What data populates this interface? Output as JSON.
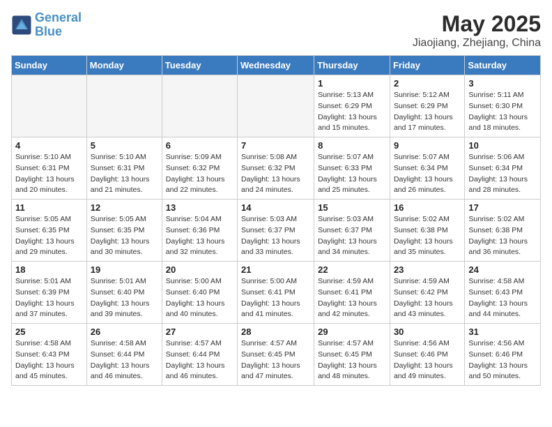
{
  "header": {
    "logo_line1": "General",
    "logo_line2": "Blue",
    "month": "May 2025",
    "location": "Jiaojiang, Zhejiang, China"
  },
  "days_of_week": [
    "Sunday",
    "Monday",
    "Tuesday",
    "Wednesday",
    "Thursday",
    "Friday",
    "Saturday"
  ],
  "weeks": [
    [
      {
        "num": "",
        "info": "",
        "empty": true
      },
      {
        "num": "",
        "info": "",
        "empty": true
      },
      {
        "num": "",
        "info": "",
        "empty": true
      },
      {
        "num": "",
        "info": "",
        "empty": true
      },
      {
        "num": "1",
        "info": "Sunrise: 5:13 AM\nSunset: 6:29 PM\nDaylight: 13 hours\nand 15 minutes."
      },
      {
        "num": "2",
        "info": "Sunrise: 5:12 AM\nSunset: 6:29 PM\nDaylight: 13 hours\nand 17 minutes."
      },
      {
        "num": "3",
        "info": "Sunrise: 5:11 AM\nSunset: 6:30 PM\nDaylight: 13 hours\nand 18 minutes."
      }
    ],
    [
      {
        "num": "4",
        "info": "Sunrise: 5:10 AM\nSunset: 6:31 PM\nDaylight: 13 hours\nand 20 minutes."
      },
      {
        "num": "5",
        "info": "Sunrise: 5:10 AM\nSunset: 6:31 PM\nDaylight: 13 hours\nand 21 minutes."
      },
      {
        "num": "6",
        "info": "Sunrise: 5:09 AM\nSunset: 6:32 PM\nDaylight: 13 hours\nand 22 minutes."
      },
      {
        "num": "7",
        "info": "Sunrise: 5:08 AM\nSunset: 6:32 PM\nDaylight: 13 hours\nand 24 minutes."
      },
      {
        "num": "8",
        "info": "Sunrise: 5:07 AM\nSunset: 6:33 PM\nDaylight: 13 hours\nand 25 minutes."
      },
      {
        "num": "9",
        "info": "Sunrise: 5:07 AM\nSunset: 6:34 PM\nDaylight: 13 hours\nand 26 minutes."
      },
      {
        "num": "10",
        "info": "Sunrise: 5:06 AM\nSunset: 6:34 PM\nDaylight: 13 hours\nand 28 minutes."
      }
    ],
    [
      {
        "num": "11",
        "info": "Sunrise: 5:05 AM\nSunset: 6:35 PM\nDaylight: 13 hours\nand 29 minutes."
      },
      {
        "num": "12",
        "info": "Sunrise: 5:05 AM\nSunset: 6:35 PM\nDaylight: 13 hours\nand 30 minutes."
      },
      {
        "num": "13",
        "info": "Sunrise: 5:04 AM\nSunset: 6:36 PM\nDaylight: 13 hours\nand 32 minutes."
      },
      {
        "num": "14",
        "info": "Sunrise: 5:03 AM\nSunset: 6:37 PM\nDaylight: 13 hours\nand 33 minutes."
      },
      {
        "num": "15",
        "info": "Sunrise: 5:03 AM\nSunset: 6:37 PM\nDaylight: 13 hours\nand 34 minutes."
      },
      {
        "num": "16",
        "info": "Sunrise: 5:02 AM\nSunset: 6:38 PM\nDaylight: 13 hours\nand 35 minutes."
      },
      {
        "num": "17",
        "info": "Sunrise: 5:02 AM\nSunset: 6:38 PM\nDaylight: 13 hours\nand 36 minutes."
      }
    ],
    [
      {
        "num": "18",
        "info": "Sunrise: 5:01 AM\nSunset: 6:39 PM\nDaylight: 13 hours\nand 37 minutes."
      },
      {
        "num": "19",
        "info": "Sunrise: 5:01 AM\nSunset: 6:40 PM\nDaylight: 13 hours\nand 39 minutes."
      },
      {
        "num": "20",
        "info": "Sunrise: 5:00 AM\nSunset: 6:40 PM\nDaylight: 13 hours\nand 40 minutes."
      },
      {
        "num": "21",
        "info": "Sunrise: 5:00 AM\nSunset: 6:41 PM\nDaylight: 13 hours\nand 41 minutes."
      },
      {
        "num": "22",
        "info": "Sunrise: 4:59 AM\nSunset: 6:41 PM\nDaylight: 13 hours\nand 42 minutes."
      },
      {
        "num": "23",
        "info": "Sunrise: 4:59 AM\nSunset: 6:42 PM\nDaylight: 13 hours\nand 43 minutes."
      },
      {
        "num": "24",
        "info": "Sunrise: 4:58 AM\nSunset: 6:43 PM\nDaylight: 13 hours\nand 44 minutes."
      }
    ],
    [
      {
        "num": "25",
        "info": "Sunrise: 4:58 AM\nSunset: 6:43 PM\nDaylight: 13 hours\nand 45 minutes."
      },
      {
        "num": "26",
        "info": "Sunrise: 4:58 AM\nSunset: 6:44 PM\nDaylight: 13 hours\nand 46 minutes."
      },
      {
        "num": "27",
        "info": "Sunrise: 4:57 AM\nSunset: 6:44 PM\nDaylight: 13 hours\nand 46 minutes."
      },
      {
        "num": "28",
        "info": "Sunrise: 4:57 AM\nSunset: 6:45 PM\nDaylight: 13 hours\nand 47 minutes."
      },
      {
        "num": "29",
        "info": "Sunrise: 4:57 AM\nSunset: 6:45 PM\nDaylight: 13 hours\nand 48 minutes."
      },
      {
        "num": "30",
        "info": "Sunrise: 4:56 AM\nSunset: 6:46 PM\nDaylight: 13 hours\nand 49 minutes."
      },
      {
        "num": "31",
        "info": "Sunrise: 4:56 AM\nSunset: 6:46 PM\nDaylight: 13 hours\nand 50 minutes."
      }
    ]
  ]
}
